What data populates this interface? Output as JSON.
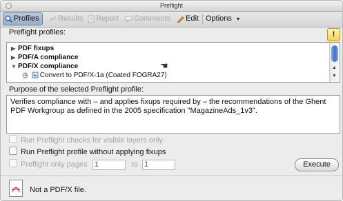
{
  "window": {
    "title": "Preflight"
  },
  "toolbar": {
    "profiles": "Profiles",
    "results": "Results",
    "report": "Report",
    "comments": "Comments",
    "edit": "Edit",
    "options": "Options",
    "options_arrow": "▾"
  },
  "profiles_label": "Preflight profiles:",
  "tree": {
    "items": [
      {
        "label": "PDF fixups",
        "expanded": false
      },
      {
        "label": "PDF/A compliance",
        "expanded": false
      },
      {
        "label": "PDF/X compliance",
        "expanded": true
      },
      {
        "label": "Convert to PDF/X-1a (Coated FOGRA27)",
        "expanded": false
      }
    ]
  },
  "purpose": {
    "label": "Purpose of the selected Preflight profile:",
    "text": "Verifies compliance with – and applies fixups required by – the recommendations of the Ghent PDF Workgroup as defined in the 2005 specification \"MagazineAds_1v3\"."
  },
  "options": {
    "visible_layers": "Run Preflight checks for visible layers only",
    "without_fixups": "Run Preflight profile without applying fixups",
    "only_pages": "Preflight only pages",
    "from_value": "1",
    "to_label": "to",
    "to_value": "1"
  },
  "execute": "Execute",
  "status": {
    "message": "Not a PDF/X file."
  }
}
